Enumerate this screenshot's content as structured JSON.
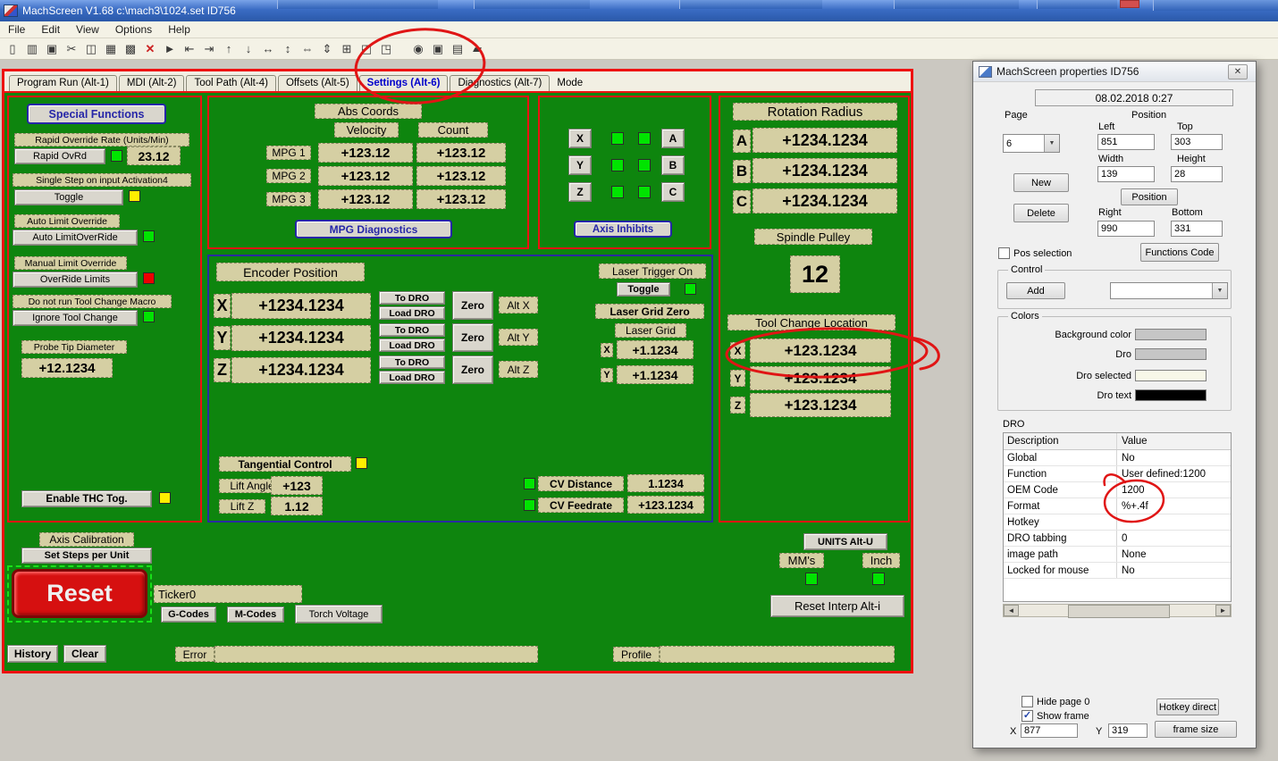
{
  "colors": {
    "screen_green": "#0e850e",
    "panel_border_red": "#ee1111",
    "panel_border_blue": "#2a2aa0",
    "label_tan": "#d5cfa3",
    "indicator_green": "#00e400",
    "indicator_yellow": "#ffee00",
    "indicator_red": "#ee0000",
    "reset_red": "#d61010",
    "active_tab_blue": "#0000cc",
    "annotation_red": "#e01515"
  },
  "titlebar": {
    "title": "MachScreen V1.68   c:\\mach3\\1024.set   ID756"
  },
  "menu": {
    "items": [
      "File",
      "Edit",
      "View",
      "Options",
      "Help"
    ]
  },
  "toolbar": {
    "icons": [
      {
        "name": "new-icon",
        "glyph": "▯"
      },
      {
        "name": "open-icon",
        "glyph": "▥"
      },
      {
        "name": "save-icon",
        "glyph": "▣"
      },
      {
        "name": "cut-icon",
        "glyph": "✂"
      },
      {
        "name": "copy-icon",
        "glyph": "◫"
      },
      {
        "name": "paste-icon",
        "glyph": "▦"
      },
      {
        "name": "duplicate-icon",
        "glyph": "▩"
      },
      {
        "name": "delete-icon",
        "glyph": "✕"
      },
      {
        "name": "pointer-icon",
        "glyph": "►"
      },
      {
        "name": "align-left-icon",
        "glyph": "⇤"
      },
      {
        "name": "align-right-icon",
        "glyph": "⇥"
      },
      {
        "name": "align-top-icon",
        "glyph": "↑"
      },
      {
        "name": "align-bottom-icon",
        "glyph": "↓"
      },
      {
        "name": "center-horizontal-icon",
        "glyph": "↔"
      },
      {
        "name": "center-vertical-icon",
        "glyph": "↕"
      },
      {
        "name": "same-width-icon",
        "glyph": "⇔"
      },
      {
        "name": "same-height-icon",
        "glyph": "⇕"
      },
      {
        "name": "grid-icon",
        "glyph": "⊞"
      },
      {
        "name": "to-front-icon",
        "glyph": "◰"
      },
      {
        "name": "to-back-icon",
        "glyph": "◳"
      },
      {
        "name": "refresh-icon",
        "glyph": "◉"
      },
      {
        "name": "screen-icon",
        "glyph": "▣"
      },
      {
        "name": "print-icon",
        "glyph": "▤"
      },
      {
        "name": "chart-icon",
        "glyph": "▰"
      }
    ]
  },
  "tabs": {
    "items": [
      "Program Run (Alt-1)",
      "MDI (Alt-2)",
      "Tool Path (Alt-4)",
      "Offsets (Alt-5)",
      "Settings (Alt-6)",
      "Diagnostics (Alt-7)"
    ],
    "mode_label": "Mode",
    "active": "Settings (Alt-6)"
  },
  "special_functions": {
    "header": "Special Functions",
    "rapid_override_rate_label": "Rapid Override Rate (Units/Min)",
    "rapid_ovrd_btn": "Rapid OvRd",
    "rapid_ovrd_value": "23.12",
    "single_step_label": "Single Step on input Activation4",
    "toggle_btn": "Toggle",
    "auto_limit_override_label": "Auto Limit Override",
    "auto_limit_override_btn": "Auto LimitOverRide",
    "manual_limit_override_label": "Manual Limit Override",
    "override_limits_btn": "OverRide Limits",
    "no_tool_change_macro_label": "Do not run Tool Change Macro",
    "ignore_tool_change_btn": "Ignore Tool Change",
    "probe_tip_diameter_label": "Probe Tip Diameter",
    "probe_tip_diameter_value": "+12.1234",
    "enable_thc_btn": "Enable THC Tog."
  },
  "abs_coords": {
    "header": "Abs Coords",
    "velocity_header": "Velocity",
    "count_header": "Count",
    "rows": [
      {
        "label": "MPG 1",
        "velocity": "+123.12",
        "count": "+123.12"
      },
      {
        "label": "MPG 2",
        "velocity": "+123.12",
        "count": "+123.12"
      },
      {
        "label": "MPG 3",
        "velocity": "+123.12",
        "count": "+123.12"
      }
    ],
    "mpg_diagnostics_btn": "MPG Diagnostics"
  },
  "axis_inhibits": {
    "header": "Axis Inhibits",
    "left": [
      "X",
      "Y",
      "Z"
    ],
    "right": [
      "A",
      "B",
      "C"
    ]
  },
  "rotation_radius": {
    "header": "Rotation Radius",
    "rows": [
      {
        "axis": "A",
        "value": "+1234.1234"
      },
      {
        "axis": "B",
        "value": "+1234.1234"
      },
      {
        "axis": "C",
        "value": "+1234.1234"
      }
    ],
    "spindle_pulley_label": "Spindle Pulley",
    "spindle_pulley_value": "12",
    "tool_change_label": "Tool Change Location",
    "tool_change_rows": [
      {
        "axis": "X",
        "value": "+123.1234"
      },
      {
        "axis": "Y",
        "value": "+123.1234"
      },
      {
        "axis": "Z",
        "value": "+123.1234"
      }
    ]
  },
  "encoder": {
    "header": "Encoder Position",
    "rows": [
      {
        "axis": "X",
        "value": "+1234.1234",
        "to_dro": "To DRO",
        "load_dro": "Load DRO",
        "zero": "Zero",
        "alt": "Alt X"
      },
      {
        "axis": "Y",
        "value": "+1234.1234",
        "to_dro": "To DRO",
        "load_dro": "Load DRO",
        "zero": "Zero",
        "alt": "Alt Y"
      },
      {
        "axis": "Z",
        "value": "+1234.1234",
        "to_dro": "To DRO",
        "load_dro": "Load DRO",
        "zero": "Zero",
        "alt": "Alt Z"
      }
    ]
  },
  "laser": {
    "trigger_label": "Laser Trigger On",
    "toggle_btn": "Toggle",
    "grid_zero_label": "Laser Grid Zero",
    "grid_label": "Laser Grid",
    "x_axis": "X",
    "x_value": "+1.1234",
    "y_axis": "Y",
    "y_value": "+1.1234"
  },
  "tangential": {
    "control_label": "Tangential Control",
    "lift_angle_label": "Lift Angle",
    "lift_angle_value": "+123",
    "lift_z_label": "Lift Z",
    "lift_z_value": "1.12"
  },
  "cv": {
    "distance_label": "CV Distance",
    "distance_value": "1.1234",
    "feedrate_label": "CV Feedrate",
    "feedrate_value": "+123.1234"
  },
  "calibration": {
    "axis_calibration_label": "Axis Calibration",
    "set_steps_btn": "Set Steps per Unit"
  },
  "reset_area": {
    "reset_btn": "Reset",
    "ticker": "Ticker0",
    "gcodes_btn": "G-Codes",
    "mcodes_btn": "M-Codes",
    "torch_voltage_btn": "Torch Voltage"
  },
  "units": {
    "units_btn": "UNITS Alt-U",
    "mms_label": "MM's",
    "inch_label": "Inch",
    "reset_interp_btn": "Reset Interp Alt-i"
  },
  "statusbar": {
    "history_btn": "History",
    "clear_btn": "Clear",
    "error_label": "Error",
    "profile_label": "Profile"
  },
  "dialog": {
    "title": "MachScreen properties  ID756",
    "datetime": "08.02.2018  0:27",
    "icons": {
      "close": "✕",
      "combo_arrow": "▼",
      "scroll_left": "◄",
      "scroll_right": "►"
    },
    "page": {
      "group_label": "Page",
      "value": "6",
      "new_btn": "New",
      "delete_btn": "Delete"
    },
    "position": {
      "group_label": "Position",
      "left_label": "Left",
      "left": "851",
      "top_label": "Top",
      "top": "303",
      "width_label": "Width",
      "width": "139",
      "height_label": "Height",
      "height": "28",
      "position_btn": "Position",
      "right_label": "Right",
      "right": "990",
      "bottom_label": "Bottom",
      "bottom": "331"
    },
    "checks": {
      "pos_selection": {
        "label": "Pos selection",
        "mark": ""
      },
      "hide_page": {
        "label": "Hide page 0",
        "mark": ""
      },
      "show_frame": {
        "label": "Show frame",
        "mark": "✓"
      }
    },
    "functions_code_btn": "Functions Code",
    "control": {
      "group_label": "Control",
      "add_btn": "Add"
    },
    "colors_group": {
      "group_label": "Colors",
      "rows": [
        {
          "label": "Background color",
          "swatch": "#c6c6c6"
        },
        {
          "label": "Dro",
          "swatch": "#c6c6c6"
        },
        {
          "label": "Dro selected",
          "swatch": "#f7f7e8"
        },
        {
          "label": "Dro text",
          "swatch": "#000000"
        }
      ]
    },
    "dro_label": "DRO",
    "table": {
      "headers": [
        "Description",
        "Value"
      ],
      "rows": [
        {
          "description": "Global",
          "value": "No"
        },
        {
          "description": "Function",
          "value": "User defined:1200"
        },
        {
          "description": "OEM Code",
          "value": "1200"
        },
        {
          "description": "Format",
          "value": "%+.4f"
        },
        {
          "description": "Hotkey",
          "value": ""
        },
        {
          "description": "DRO tabbing",
          "value": "0"
        },
        {
          "description": "image path",
          "value": "None"
        },
        {
          "description": "Locked for mouse",
          "value": "No"
        }
      ]
    },
    "hotkey_direct_btn": "Hotkey direct",
    "frame_size_btn": "frame size",
    "x_label": "X",
    "x_value": "877",
    "y_label": "Y",
    "y_value": "319"
  }
}
